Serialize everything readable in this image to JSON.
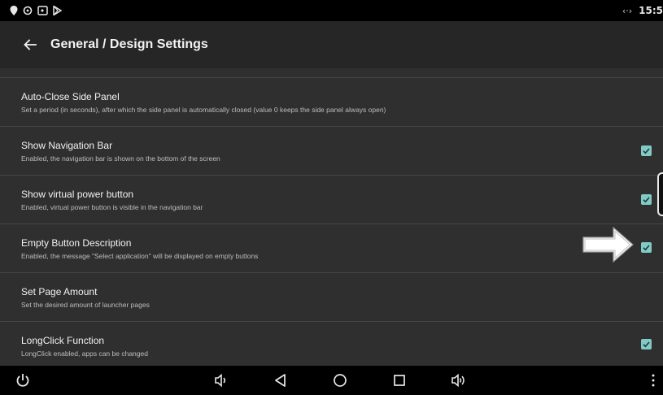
{
  "status_bar": {
    "clock": "15:5",
    "network_code": "‹·›",
    "left_icons": [
      "location-icon",
      "sync-icon",
      "screencast-icon",
      "play-store-icon"
    ]
  },
  "app_bar": {
    "title": "General / Design Settings",
    "back_icon": "arrow-left-icon"
  },
  "settings": [
    {
      "title": "Auto-Close Side Panel",
      "summary": "Set a period (in seconds), after which the side panel is automatically closed (value 0 keeps the side panel always open)",
      "has_checkbox": false
    },
    {
      "title": "Show Navigation Bar",
      "summary": "Enabled, the navigation bar is shown on the bottom of the screen",
      "has_checkbox": true,
      "checked": true
    },
    {
      "title": "Show virtual power button",
      "summary": "Enabled, virtual power button is visible in the navigation bar",
      "has_checkbox": true,
      "checked": true
    },
    {
      "title": "Empty Button Description",
      "summary": "Enabled, the message \"Select application\" will be displayed on empty buttons",
      "has_checkbox": true,
      "checked": true
    },
    {
      "title": "Set Page Amount",
      "summary": "Set the desired amount of launcher pages",
      "has_checkbox": false
    },
    {
      "title": "LongClick Function",
      "summary": "LongClick enabled, apps can be changed",
      "has_checkbox": true,
      "checked": true
    }
  ],
  "nav_bar": {
    "icons": [
      "power-icon",
      "volume-down-icon",
      "back-icon",
      "home-icon",
      "recents-icon",
      "volume-up-icon",
      "more-vert-icon"
    ]
  },
  "colors": {
    "background": "#2f2f2f",
    "app_bar": "#262626",
    "checkbox_accent": "#80cbc4",
    "divider": "#454545"
  }
}
